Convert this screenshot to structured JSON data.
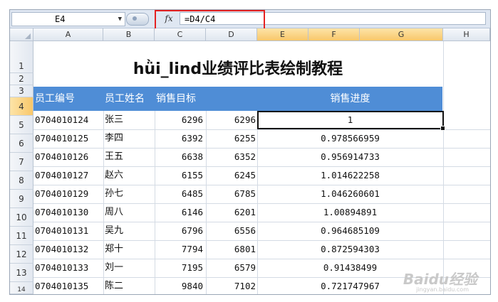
{
  "formula_bar": {
    "name_box": "E4",
    "fx": "fx",
    "formula": "=D4/C4"
  },
  "columns": [
    "A",
    "B",
    "C",
    "D",
    "E",
    "F",
    "G",
    "H"
  ],
  "rows": [
    "1",
    "2",
    "3",
    "4",
    "5",
    "6",
    "7",
    "8",
    "9",
    "10",
    "11",
    "12",
    "13",
    "14"
  ],
  "title": "hǜi_lind业绩评比表绘制教程",
  "headers": {
    "emp_id": "员工编号",
    "emp_name": "员工姓名",
    "target": "销售目标",
    "progress": "销售进度"
  },
  "records": [
    {
      "id": "0704010124",
      "name": "张三",
      "target": "6296",
      "actual": "6296",
      "progress": "1"
    },
    {
      "id": "0704010125",
      "name": "李四",
      "target": "6392",
      "actual": "6255",
      "progress": "0.978566959"
    },
    {
      "id": "0704010126",
      "name": "王五",
      "target": "6638",
      "actual": "6352",
      "progress": "0.956914733"
    },
    {
      "id": "0704010127",
      "name": "赵六",
      "target": "6155",
      "actual": "6245",
      "progress": "1.014622258"
    },
    {
      "id": "0704010129",
      "name": "孙七",
      "target": "6485",
      "actual": "6785",
      "progress": "1.046260601"
    },
    {
      "id": "0704010130",
      "name": "周八",
      "target": "6146",
      "actual": "6201",
      "progress": "1.00894891"
    },
    {
      "id": "0704010131",
      "name": "吴九",
      "target": "6796",
      "actual": "6556",
      "progress": "0.964685109"
    },
    {
      "id": "0704010132",
      "name": "郑十",
      "target": "7794",
      "actual": "6801",
      "progress": "0.872594303"
    },
    {
      "id": "0704010133",
      "name": "刘一",
      "target": "7195",
      "actual": "6579",
      "progress": "0.91438499"
    },
    {
      "id": "0704010135",
      "name": "陈二",
      "target": "9840",
      "actual": "7102",
      "progress": "0.721747967"
    }
  ],
  "watermark": {
    "logo": "Baidu经验",
    "sub": "jingyan.baidu.com"
  },
  "colors": {
    "header_band": "#4f8dd6",
    "selection": "#f8c76a",
    "highlight_box": "#e52222"
  }
}
